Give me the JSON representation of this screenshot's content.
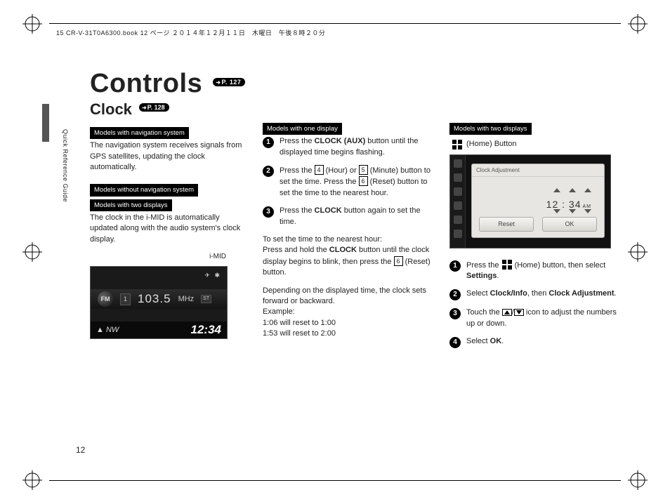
{
  "header": "15 CR-V-31T0A6300.book  12 ページ  ２０１４年１２月１１日　木曜日　午後８時２０分",
  "side_label": "Quick Reference Guide",
  "page_number": "12",
  "title": "Controls",
  "title_ref": "P. 127",
  "subtitle": "Clock",
  "subtitle_ref": "P. 128",
  "col1": {
    "tag1": "Models with navigation system",
    "para1": "The navigation system receives signals from GPS satellites, updating the clock automatically.",
    "tag2": "Models without navigation system",
    "tag3": "Models with two displays",
    "para2": "The clock in the i-MID is automatically updated along with the audio system's clock display.",
    "imid_label": "i-MID",
    "display": {
      "icons": "✈  ✱",
      "band": "FM",
      "preset": "1",
      "freq": "103.5",
      "unit": "MHz",
      "st": "ST",
      "compass": "▲ NW",
      "clock": "12:34"
    }
  },
  "col2": {
    "tag": "Models with one display",
    "step1a": "Press the ",
    "step1b": "CLOCK (AUX)",
    "step1c": " button until the displayed time begins flashing.",
    "step2a": "Press the ",
    "step2_k1": "4",
    "step2b": " (Hour) or ",
    "step2_k2": "5",
    "step2c": " (Minute) button to set the time. Press the ",
    "step2_k3": "6",
    "step2d": " (Reset) button to set the time to the nearest hour.",
    "step3a": "Press the ",
    "step3b": "CLOCK",
    "step3c": " button again to set the time.",
    "mid1": "To set the time to the nearest hour:",
    "mid2a": "Press and hold the ",
    "mid2b": "CLOCK",
    "mid2c": " button until the clock display begins to blink, then press the ",
    "mid2_k": "6",
    "mid2d": " (Reset) button.",
    "mid3": "Depending on the displayed time, the clock sets forward or backward.",
    "mid4": "Example:",
    "mid5": "1:06 will reset to 1:00",
    "mid6": "1:53 will reset to 2:00"
  },
  "col3": {
    "tag": "Models with two displays",
    "home_label": "(Home) Button",
    "panel": {
      "title": "Clock Adjustment",
      "time": "12 : 34",
      "ampm": "AM",
      "reset": "Reset",
      "ok": "OK"
    },
    "step1a": "Press the ",
    "step1b": " (Home) button, then select ",
    "step1c": "Settings",
    "step1d": ".",
    "step2a": "Select ",
    "step2b": "Clock/Info",
    "step2c": ", then ",
    "step2d": "Clock Adjustment",
    "step2e": ".",
    "step3a": "Touch the ",
    "step3b": " icon to adjust the numbers up or down.",
    "step4a": "Select ",
    "step4b": "OK",
    "step4c": "."
  }
}
